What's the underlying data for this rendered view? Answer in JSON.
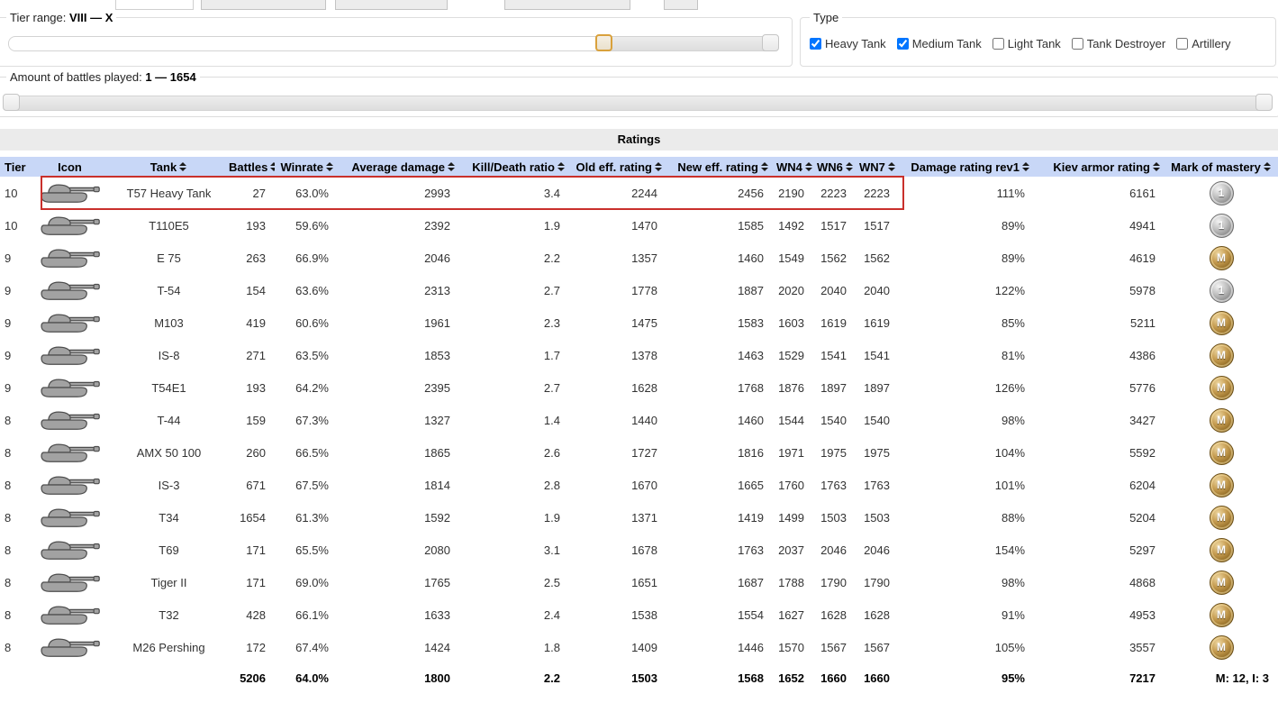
{
  "filters": {
    "tier_range": {
      "label": "Tier range:",
      "value": "VIII — X"
    },
    "battles": {
      "label": "Amount of battles played:",
      "value": "1 — 1654"
    },
    "type": {
      "legend": "Type",
      "options": [
        {
          "label": "Heavy Tank",
          "checked": true
        },
        {
          "label": "Medium Tank",
          "checked": true
        },
        {
          "label": "Light Tank",
          "checked": false
        },
        {
          "label": "Tank Destroyer",
          "checked": false
        },
        {
          "label": "Artillery",
          "checked": false
        }
      ]
    }
  },
  "table": {
    "title": "Ratings",
    "columns": [
      {
        "label": "Tier",
        "sortable": true
      },
      {
        "label": "Icon",
        "sortable": false
      },
      {
        "label": "Tank",
        "sortable": true
      },
      {
        "label": "Battles",
        "sortable": true
      },
      {
        "label": "Winrate",
        "sortable": true
      },
      {
        "label": "Average damage",
        "sortable": true
      },
      {
        "label": "Kill/Death ratio",
        "sortable": true
      },
      {
        "label": "Old eff. rating",
        "sortable": true
      },
      {
        "label": "New eff. rating",
        "sortable": true
      },
      {
        "label": "WN4",
        "sortable": true
      },
      {
        "label": "WN6",
        "sortable": true
      },
      {
        "label": "WN7",
        "sortable": true
      },
      {
        "label": "Damage rating rev1",
        "sortable": true
      },
      {
        "label": "Kiev armor rating",
        "sortable": true
      },
      {
        "label": "Mark of mastery",
        "sortable": true
      }
    ],
    "rows": [
      {
        "tier": "10",
        "icon": "tank-silhouette",
        "tank": "T57 Heavy Tank",
        "battles": "27",
        "winrate": "63.0%",
        "avg_damage": "2993",
        "kd": "3.4",
        "old_eff": "2244",
        "new_eff": "2456",
        "wn4": "2190",
        "wn6": "2223",
        "wn7": "2223",
        "damage_rev1": "111%",
        "kiev": "6161",
        "mastery": "1",
        "highlighted": true
      },
      {
        "tier": "10",
        "icon": "tank-silhouette",
        "tank": "T110E5",
        "battles": "193",
        "winrate": "59.6%",
        "avg_damage": "2392",
        "kd": "1.9",
        "old_eff": "1470",
        "new_eff": "1585",
        "wn4": "1492",
        "wn6": "1517",
        "wn7": "1517",
        "damage_rev1": "89%",
        "kiev": "4941",
        "mastery": "1",
        "highlighted": false
      },
      {
        "tier": "9",
        "icon": "tank-silhouette",
        "tank": "E 75",
        "battles": "263",
        "winrate": "66.9%",
        "avg_damage": "2046",
        "kd": "2.2",
        "old_eff": "1357",
        "new_eff": "1460",
        "wn4": "1549",
        "wn6": "1562",
        "wn7": "1562",
        "damage_rev1": "89%",
        "kiev": "4619",
        "mastery": "M",
        "highlighted": false
      },
      {
        "tier": "9",
        "icon": "tank-silhouette",
        "tank": "T-54",
        "battles": "154",
        "winrate": "63.6%",
        "avg_damage": "2313",
        "kd": "2.7",
        "old_eff": "1778",
        "new_eff": "1887",
        "wn4": "2020",
        "wn6": "2040",
        "wn7": "2040",
        "damage_rev1": "122%",
        "kiev": "5978",
        "mastery": "1",
        "highlighted": false
      },
      {
        "tier": "9",
        "icon": "tank-silhouette",
        "tank": "M103",
        "battles": "419",
        "winrate": "60.6%",
        "avg_damage": "1961",
        "kd": "2.3",
        "old_eff": "1475",
        "new_eff": "1583",
        "wn4": "1603",
        "wn6": "1619",
        "wn7": "1619",
        "damage_rev1": "85%",
        "kiev": "5211",
        "mastery": "M",
        "highlighted": false
      },
      {
        "tier": "9",
        "icon": "tank-silhouette",
        "tank": "IS-8",
        "battles": "271",
        "winrate": "63.5%",
        "avg_damage": "1853",
        "kd": "1.7",
        "old_eff": "1378",
        "new_eff": "1463",
        "wn4": "1529",
        "wn6": "1541",
        "wn7": "1541",
        "damage_rev1": "81%",
        "kiev": "4386",
        "mastery": "M",
        "highlighted": false
      },
      {
        "tier": "9",
        "icon": "tank-silhouette",
        "tank": "T54E1",
        "battles": "193",
        "winrate": "64.2%",
        "avg_damage": "2395",
        "kd": "2.7",
        "old_eff": "1628",
        "new_eff": "1768",
        "wn4": "1876",
        "wn6": "1897",
        "wn7": "1897",
        "damage_rev1": "126%",
        "kiev": "5776",
        "mastery": "M",
        "highlighted": false
      },
      {
        "tier": "8",
        "icon": "tank-silhouette",
        "tank": "T-44",
        "battles": "159",
        "winrate": "67.3%",
        "avg_damage": "1327",
        "kd": "1.4",
        "old_eff": "1440",
        "new_eff": "1460",
        "wn4": "1544",
        "wn6": "1540",
        "wn7": "1540",
        "damage_rev1": "98%",
        "kiev": "3427",
        "mastery": "M",
        "highlighted": false
      },
      {
        "tier": "8",
        "icon": "tank-silhouette",
        "tank": "AMX 50 100",
        "battles": "260",
        "winrate": "66.5%",
        "avg_damage": "1865",
        "kd": "2.6",
        "old_eff": "1727",
        "new_eff": "1816",
        "wn4": "1971",
        "wn6": "1975",
        "wn7": "1975",
        "damage_rev1": "104%",
        "kiev": "5592",
        "mastery": "M",
        "highlighted": false
      },
      {
        "tier": "8",
        "icon": "tank-silhouette",
        "tank": "IS-3",
        "battles": "671",
        "winrate": "67.5%",
        "avg_damage": "1814",
        "kd": "2.8",
        "old_eff": "1670",
        "new_eff": "1665",
        "wn4": "1760",
        "wn6": "1763",
        "wn7": "1763",
        "damage_rev1": "101%",
        "kiev": "6204",
        "mastery": "M",
        "highlighted": false
      },
      {
        "tier": "8",
        "icon": "tank-silhouette",
        "tank": "T34",
        "battles": "1654",
        "winrate": "61.3%",
        "avg_damage": "1592",
        "kd": "1.9",
        "old_eff": "1371",
        "new_eff": "1419",
        "wn4": "1499",
        "wn6": "1503",
        "wn7": "1503",
        "damage_rev1": "88%",
        "kiev": "5204",
        "mastery": "M",
        "highlighted": false
      },
      {
        "tier": "8",
        "icon": "tank-silhouette",
        "tank": "T69",
        "battles": "171",
        "winrate": "65.5%",
        "avg_damage": "2080",
        "kd": "3.1",
        "old_eff": "1678",
        "new_eff": "1763",
        "wn4": "2037",
        "wn6": "2046",
        "wn7": "2046",
        "damage_rev1": "154%",
        "kiev": "5297",
        "mastery": "M",
        "highlighted": false
      },
      {
        "tier": "8",
        "icon": "tank-silhouette",
        "tank": "Tiger II",
        "battles": "171",
        "winrate": "69.0%",
        "avg_damage": "1765",
        "kd": "2.5",
        "old_eff": "1651",
        "new_eff": "1687",
        "wn4": "1788",
        "wn6": "1790",
        "wn7": "1790",
        "damage_rev1": "98%",
        "kiev": "4868",
        "mastery": "M",
        "highlighted": false
      },
      {
        "tier": "8",
        "icon": "tank-silhouette",
        "tank": "T32",
        "battles": "428",
        "winrate": "66.1%",
        "avg_damage": "1633",
        "kd": "2.4",
        "old_eff": "1538",
        "new_eff": "1554",
        "wn4": "1627",
        "wn6": "1628",
        "wn7": "1628",
        "damage_rev1": "91%",
        "kiev": "4953",
        "mastery": "M",
        "highlighted": false
      },
      {
        "tier": "8",
        "icon": "tank-silhouette",
        "tank": "M26 Pershing",
        "battles": "172",
        "winrate": "67.4%",
        "avg_damage": "1424",
        "kd": "1.8",
        "old_eff": "1409",
        "new_eff": "1446",
        "wn4": "1570",
        "wn6": "1567",
        "wn7": "1567",
        "damage_rev1": "105%",
        "kiev": "3557",
        "mastery": "M",
        "highlighted": false
      }
    ],
    "totals": {
      "battles": "5206",
      "winrate": "64.0%",
      "avg_damage": "1800",
      "kd": "2.2",
      "old_eff": "1503",
      "new_eff": "1568",
      "wn4": "1652",
      "wn6": "1660",
      "wn7": "1660",
      "damage_rev1": "95%",
      "kiev": "7217",
      "mastery_summary": "M: 12, I: 3"
    }
  },
  "colors": {
    "header_band": "#c8d7f7",
    "title_band": "#ebebeb",
    "highlight_border": "#c9302c",
    "mastery_gold": "#a9812f",
    "mastery_silver": "#9e9e9e",
    "focused_handle_border": "#d9a13c"
  }
}
